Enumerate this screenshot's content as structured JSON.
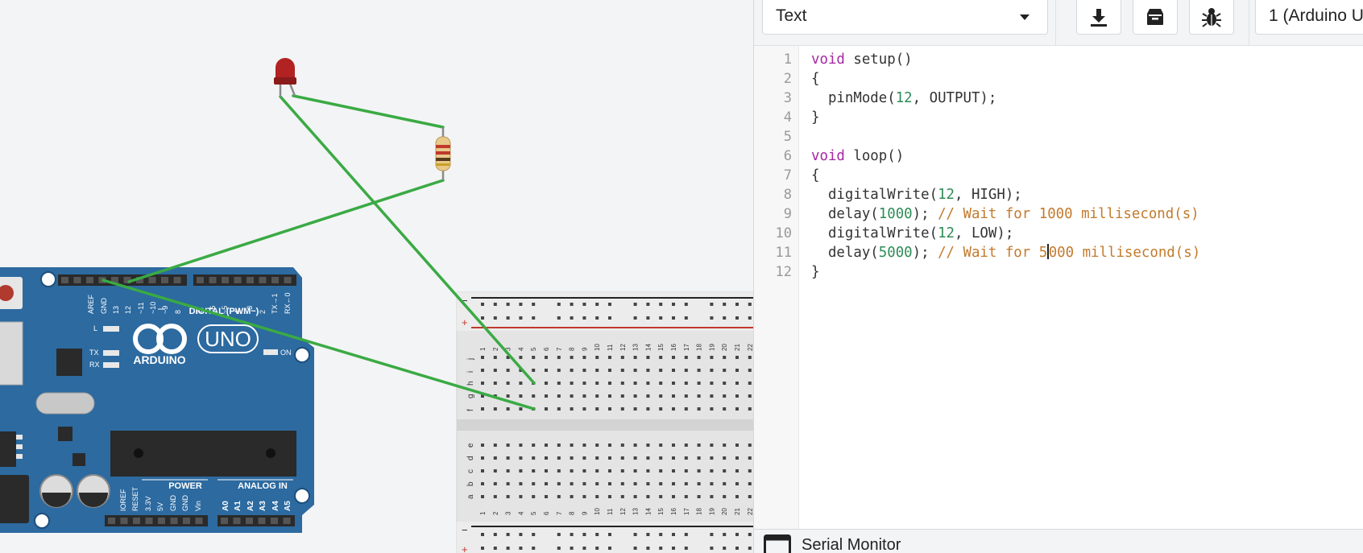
{
  "toolbar": {
    "mode_dropdown": "Text",
    "download_icon": "download-icon",
    "upload_icon": "upload-to-board-icon",
    "debug_icon": "bug-icon",
    "board_select": "1 (Arduino U"
  },
  "editor": {
    "line_numbers": [
      "1",
      "2",
      "3",
      "4",
      "5",
      "6",
      "7",
      "8",
      "9",
      "10",
      "11",
      "12"
    ],
    "lines": [
      [
        {
          "t": "void",
          "c": "kw"
        },
        {
          "t": " setup()",
          "c": ""
        }
      ],
      [
        {
          "t": "{",
          "c": ""
        }
      ],
      [
        {
          "t": "  pinMode(",
          "c": ""
        },
        {
          "t": "12",
          "c": "num"
        },
        {
          "t": ", OUTPUT);",
          "c": ""
        }
      ],
      [
        {
          "t": "}",
          "c": ""
        }
      ],
      [],
      [
        {
          "t": "void",
          "c": "kw"
        },
        {
          "t": " loop()",
          "c": ""
        }
      ],
      [
        {
          "t": "{",
          "c": ""
        }
      ],
      [
        {
          "t": "  digitalWrite(",
          "c": ""
        },
        {
          "t": "12",
          "c": "num"
        },
        {
          "t": ", HIGH);",
          "c": ""
        }
      ],
      [
        {
          "t": "  delay(",
          "c": ""
        },
        {
          "t": "1000",
          "c": "num"
        },
        {
          "t": "); ",
          "c": ""
        },
        {
          "t": "// Wait for 1000 millisecond(s)",
          "c": "cmt"
        }
      ],
      [
        {
          "t": "  digitalWrite(",
          "c": ""
        },
        {
          "t": "12",
          "c": "num"
        },
        {
          "t": ", LOW);",
          "c": ""
        }
      ],
      [
        {
          "t": "  delay(",
          "c": ""
        },
        {
          "t": "5000",
          "c": "num"
        },
        {
          "t": "); ",
          "c": ""
        },
        {
          "t": "// Wait for 5",
          "c": "cmt"
        },
        {
          "t": "|cursor|",
          "c": "cursor"
        },
        {
          "t": "000 millisecond(s)",
          "c": "cmt"
        }
      ],
      [
        {
          "t": "}",
          "c": ""
        }
      ]
    ]
  },
  "serial_monitor": {
    "label": "Serial Monitor",
    "icon": "serial-monitor-icon"
  },
  "circuit": {
    "board": {
      "brand": "ARDUINO",
      "model": "UNO",
      "top_pin_labels": [
        "AREF",
        "GND",
        "13",
        "12",
        "~11",
        "~10",
        "~9",
        "8",
        "7",
        "~6",
        "~5",
        "4",
        "~3",
        "2",
        "TX→1",
        "RX←0"
      ],
      "digital_label": "DIGITAL (PWM~)",
      "led_labels": [
        "L",
        "TX",
        "RX"
      ],
      "on_label": "ON",
      "power_label": "POWER",
      "analog_label": "ANALOG IN",
      "power_pins": [
        "IOREF",
        "RESET",
        "3.3V",
        "5V",
        "GND",
        "GND",
        "Vin"
      ],
      "analog_pins": [
        "A0",
        "A1",
        "A2",
        "A3",
        "A4",
        "A5"
      ]
    },
    "breadboard": {
      "top_rows": [
        "j",
        "i",
        "h",
        "g",
        "f"
      ],
      "bottom_rows": [
        "e",
        "d",
        "c",
        "b",
        "a"
      ],
      "columns": [
        "1",
        "2",
        "3",
        "4",
        "5",
        "6",
        "7",
        "8",
        "9",
        "10",
        "11",
        "12",
        "13",
        "14",
        "15",
        "16",
        "17",
        "18",
        "19",
        "20",
        "21",
        "22"
      ],
      "rail_minus": "−",
      "rail_plus": "+"
    },
    "colors": {
      "wire": "#3aaa44",
      "board": "#2c6aa0",
      "led": "#b22222"
    }
  }
}
